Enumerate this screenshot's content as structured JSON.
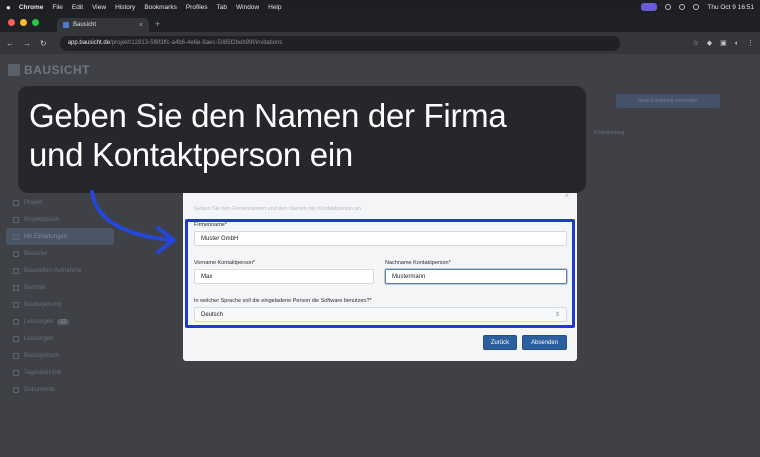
{
  "menubar": {
    "apple": "",
    "items": [
      "Chrome",
      "File",
      "Edit",
      "View",
      "History",
      "Bookmarks",
      "Profiles",
      "Tab",
      "Window",
      "Help"
    ],
    "clock": "Thu Oct 9  16:51"
  },
  "browser": {
    "tab_title": "Bausicht",
    "new_tab": "+",
    "close_tab": "×",
    "url_host": "app.bausicht.de",
    "url_rest": "/projekt/12813-5f8f3ffc-a4b6-4e6e-8aec-5085f2beb99f/invitations"
  },
  "app": {
    "brand": "BAUSICHT",
    "sidebar": [
      {
        "label": "Projekt",
        "active": false
      },
      {
        "label": "Projektdetails",
        "active": false
      },
      {
        "label": "Mit Einladungen",
        "active": true
      },
      {
        "label": "Besuche",
        "active": false
      },
      {
        "label": "Baustellen-Aufnahme",
        "active": false
      },
      {
        "label": "Berichte",
        "active": false
      },
      {
        "label": "Baubegehung",
        "active": false
      },
      {
        "label": "Leistungen",
        "active": false,
        "badge": "12"
      },
      {
        "label": "Leistungen",
        "active": false
      },
      {
        "label": "Bautagebuch",
        "active": false
      },
      {
        "label": "Tagesberichte",
        "active": false
      },
      {
        "label": "Dokumente",
        "active": false
      }
    ],
    "bg_button": "Neue Einladung versenden",
    "bg_label": "Projektleitung"
  },
  "banner": {
    "line1": "Geben Sie den Namen der Firma",
    "line2": "und Kontaktperson ein"
  },
  "modal": {
    "close": "×",
    "description": "Geben Sie den Firmennamen und den Namen der Kontaktperson an.",
    "company_label": "Firmenname*",
    "company_value": "Muster GmbH",
    "first_label": "Vorname Kontaktperson*",
    "first_value": "Max",
    "last_label": "Nachname Kontaktperson*",
    "last_value": "Mustermann",
    "language_label": "In welcher Sprache soll die eingeladene Person die Software benutzen?*",
    "language_value": "Deutsch",
    "back_button": "Zurück",
    "send_button": "Absenden"
  },
  "colors": {
    "highlight": "#1f3ad0",
    "primary_button": "#2b5f9e",
    "banner_bg": "#25272a"
  }
}
